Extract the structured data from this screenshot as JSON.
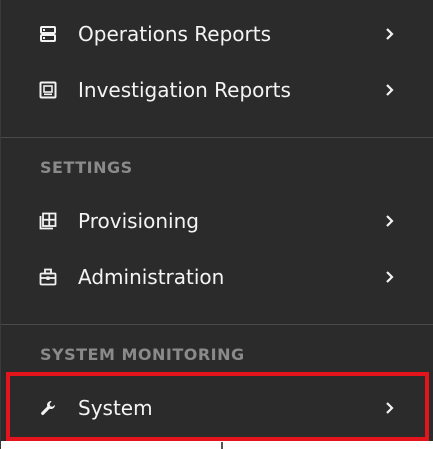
{
  "menu": {
    "items_top": [
      {
        "label": "Operations Reports",
        "icon": "server-stack-icon"
      },
      {
        "label": "Investigation Reports",
        "icon": "report-window-icon"
      }
    ],
    "settings_heading": "SETTINGS",
    "settings_items": [
      {
        "label": "Provisioning",
        "icon": "grid-plus-icon"
      },
      {
        "label": "Administration",
        "icon": "toolbox-icon"
      }
    ],
    "monitoring_heading": "SYSTEM MONITORING",
    "monitoring_items": [
      {
        "label": "System",
        "icon": "wrench-icon",
        "highlighted": true
      }
    ]
  },
  "colors": {
    "background": "#2b2b2b",
    "text": "#f4f4f4",
    "section_heading": "#8a8a8a",
    "highlight_border": "#e3141b"
  }
}
